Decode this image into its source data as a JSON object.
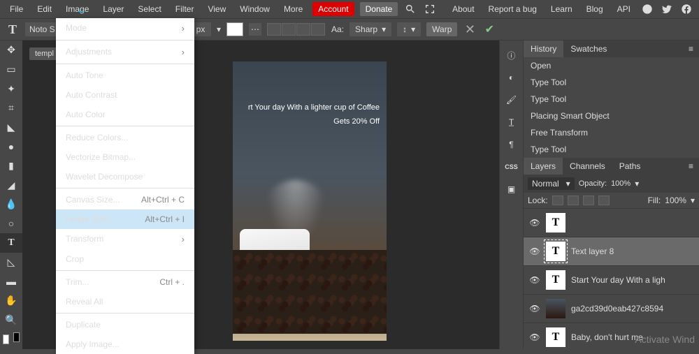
{
  "menubar": {
    "items": [
      "File",
      "Edit",
      "Image",
      "Layer",
      "Select",
      "Filter",
      "View",
      "Window",
      "More"
    ],
    "account": "Account",
    "donate": "Donate",
    "right": [
      "About",
      "Report a bug",
      "Learn",
      "Blog",
      "API"
    ]
  },
  "arrow_target": "Image",
  "optbar": {
    "font": "Noto S",
    "unit": "px",
    "aa_label": "Aa:",
    "aa_value": "Sharp",
    "warp": "Warp"
  },
  "tab": "templ",
  "canvas": {
    "line1": "rt Your day With a lighter cup of Coffee",
    "line2": "Gets 20% Off"
  },
  "dropdown": {
    "items": [
      {
        "label": "Mode",
        "type": "sub"
      },
      {
        "type": "sep"
      },
      {
        "label": "Adjustments",
        "type": "sub"
      },
      {
        "type": "sep"
      },
      {
        "label": "Auto Tone",
        "type": "disabled"
      },
      {
        "label": "Auto Contrast",
        "type": "disabled"
      },
      {
        "label": "Auto Color",
        "type": "disabled"
      },
      {
        "type": "sep"
      },
      {
        "label": "Reduce Colors...",
        "type": "disabled"
      },
      {
        "label": "Vectorize Bitmap...",
        "type": "disabled"
      },
      {
        "label": "Wavelet Decompose",
        "type": "disabled"
      },
      {
        "type": "sep"
      },
      {
        "label": "Canvas Size...",
        "shortcut": "Alt+Ctrl + C"
      },
      {
        "label": "Image Size...",
        "shortcut": "Alt+Ctrl + I",
        "hl": true
      },
      {
        "label": "Transform",
        "type": "sub"
      },
      {
        "label": "Crop",
        "type": "disabled"
      },
      {
        "type": "sep"
      },
      {
        "label": "Trim...",
        "shortcut": "Ctrl + ."
      },
      {
        "label": "Reveal All"
      },
      {
        "type": "sep"
      },
      {
        "label": "Duplicate"
      },
      {
        "label": "Apply Image...",
        "type": "disabled"
      }
    ]
  },
  "panels": {
    "history": {
      "tab1": "History",
      "tab2": "Swatches",
      "items": [
        "Open",
        "Type Tool",
        "Type Tool",
        "Placing Smart Object",
        "Free Transform",
        "Type Tool"
      ]
    },
    "layers": {
      "tab1": "Layers",
      "tab2": "Channels",
      "tab3": "Paths",
      "blend": "Normal",
      "opacity_label": "Opacity:",
      "opacity": "100%",
      "lock_label": "Lock:",
      "fill_label": "Fill:",
      "fill": "100%",
      "layers": [
        {
          "type": "T",
          "name": ""
        },
        {
          "type": "T",
          "name": "Text layer 8",
          "sel": true,
          "dashed": true
        },
        {
          "type": "T",
          "name": "Start Your day With a ligh"
        },
        {
          "type": "img",
          "name": "ga2cd39d0eab427c8594"
        },
        {
          "type": "T",
          "name": "Baby, don't hurt me"
        }
      ]
    }
  },
  "watermark": "Activate Wind"
}
